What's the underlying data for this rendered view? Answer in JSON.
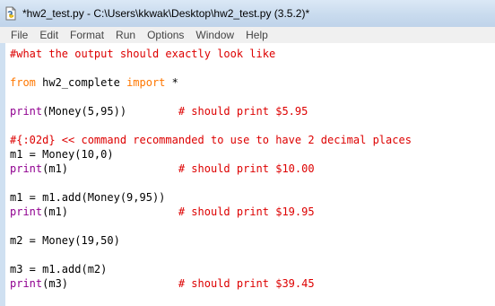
{
  "window": {
    "title": "*hw2_test.py - C:\\Users\\kkwak\\Desktop\\hw2_test.py (3.5.2)*",
    "icon": "python-file-icon"
  },
  "menu": {
    "items": [
      "File",
      "Edit",
      "Format",
      "Run",
      "Options",
      "Window",
      "Help"
    ]
  },
  "editor": {
    "colors": {
      "keyword": "#ff7700",
      "builtin": "#900090",
      "comment": "#dd0000",
      "text": "#000000"
    },
    "lines": [
      [
        {
          "t": "#what the output should exactly look like",
          "c": "cm"
        }
      ],
      [],
      [
        {
          "t": "from",
          "c": "kw"
        },
        {
          "t": " hw2_complete ",
          "c": "pl"
        },
        {
          "t": "import",
          "c": "kw"
        },
        {
          "t": " *",
          "c": "pl"
        }
      ],
      [],
      [
        {
          "t": "print",
          "c": "bi"
        },
        {
          "t": "(Money(5,95))        ",
          "c": "pl"
        },
        {
          "t": "# should print $5.95",
          "c": "cm"
        }
      ],
      [],
      [
        {
          "t": "#{:02d} << command recommanded to use to have 2 decimal places",
          "c": "cm"
        }
      ],
      [
        {
          "t": "m1 = Money(10,0)",
          "c": "pl"
        }
      ],
      [
        {
          "t": "print",
          "c": "bi"
        },
        {
          "t": "(m1)                 ",
          "c": "pl"
        },
        {
          "t": "# should print $10.00",
          "c": "cm"
        }
      ],
      [],
      [
        {
          "t": "m1 = m1.add(Money(9,95))",
          "c": "pl"
        }
      ],
      [
        {
          "t": "print",
          "c": "bi"
        },
        {
          "t": "(m1)                 ",
          "c": "pl"
        },
        {
          "t": "# should print $19.95",
          "c": "cm"
        }
      ],
      [],
      [
        {
          "t": "m2 = Money(19,50)",
          "c": "pl"
        }
      ],
      [],
      [
        {
          "t": "m3 = m1.add(m2)",
          "c": "pl"
        }
      ],
      [
        {
          "t": "print",
          "c": "bi"
        },
        {
          "t": "(m3)                 ",
          "c": "pl"
        },
        {
          "t": "# should print $39.45",
          "c": "cm"
        }
      ]
    ]
  }
}
